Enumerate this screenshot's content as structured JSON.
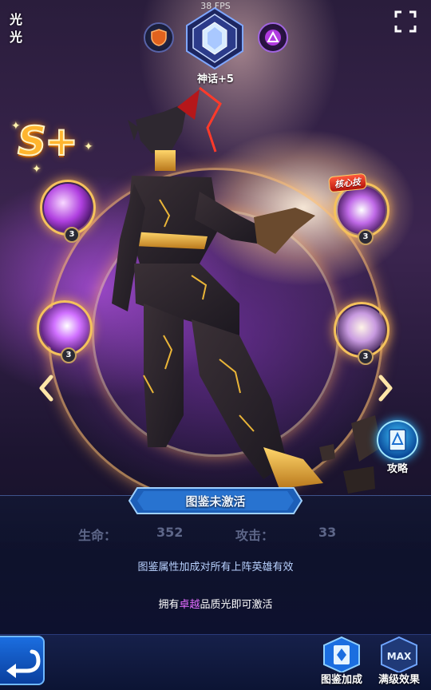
{
  "fps": "38 FPS",
  "hero_name": "光光",
  "rank": {
    "label": "神话+5"
  },
  "grade": "S+",
  "core_skill_tag": "核心技",
  "skills": [
    {
      "level": "3"
    },
    {
      "level": "3"
    },
    {
      "level": "3"
    },
    {
      "level": "3"
    }
  ],
  "guide": {
    "label": "攻略"
  },
  "codex": {
    "banner": "图鉴未激活",
    "hp_label": "生命：",
    "hp_value": "352",
    "atk_label": "攻击：",
    "atk_value": "33",
    "description": "图鉴属性加成对所有上阵英雄有效",
    "hint_prefix": "拥有",
    "hint_highlight": "卓越",
    "hint_suffix": "品质光即可激活"
  },
  "bottom_bar": {
    "codex_bonus_label": "图鉴加成",
    "max_effect_label": "满级效果"
  },
  "colors": {
    "accent_gold": "#f5c25c",
    "highlight_purple": "#e36cff",
    "stat_gray": "#5d6688",
    "button_blue": "#1b6ee0"
  }
}
